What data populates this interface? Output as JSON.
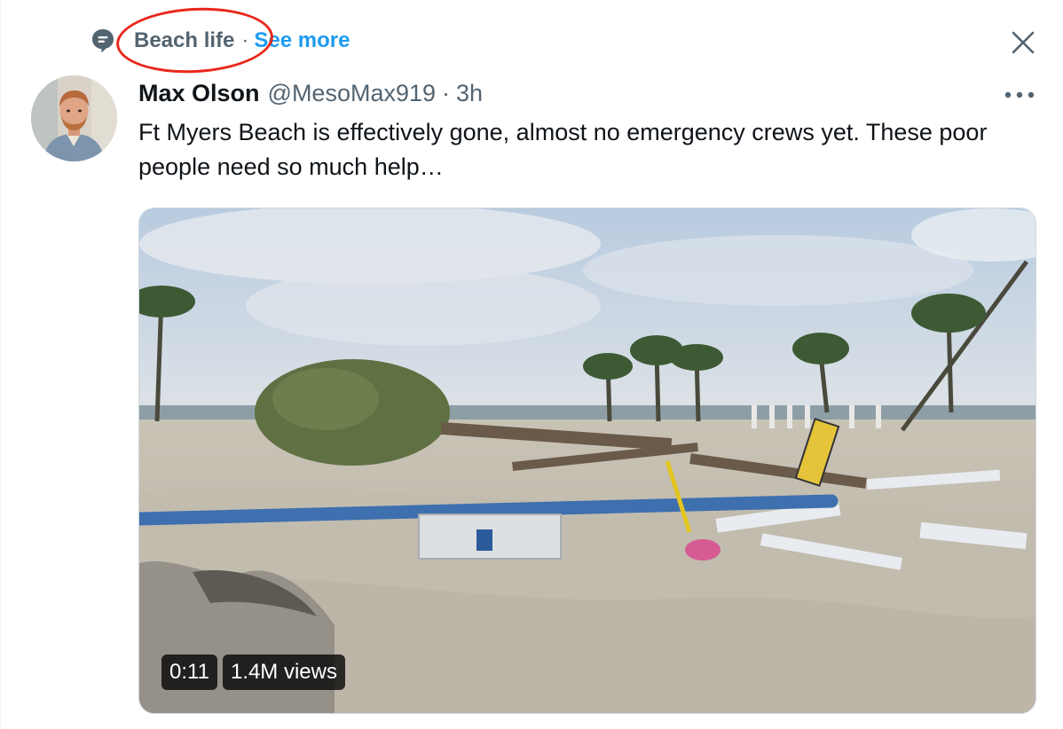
{
  "topic": {
    "name": "Beach life",
    "separator": "·",
    "see_more": "See more"
  },
  "tweet": {
    "author_name": "Max Olson",
    "handle": "@MesoMax919",
    "separator": "·",
    "time": "3h",
    "text": "Ft Myers Beach is effectively gone, almost no emergency crews yet. These poor people need so much help…"
  },
  "video": {
    "duration": "0:11",
    "views": "1.4M views"
  },
  "icons": {
    "topic": "topic-bubble-icon",
    "close": "close-icon",
    "more": "more-dots-icon"
  },
  "colors": {
    "accent": "#1d9bf0",
    "secondary_text": "#536471",
    "annotation": "#e8271b"
  }
}
